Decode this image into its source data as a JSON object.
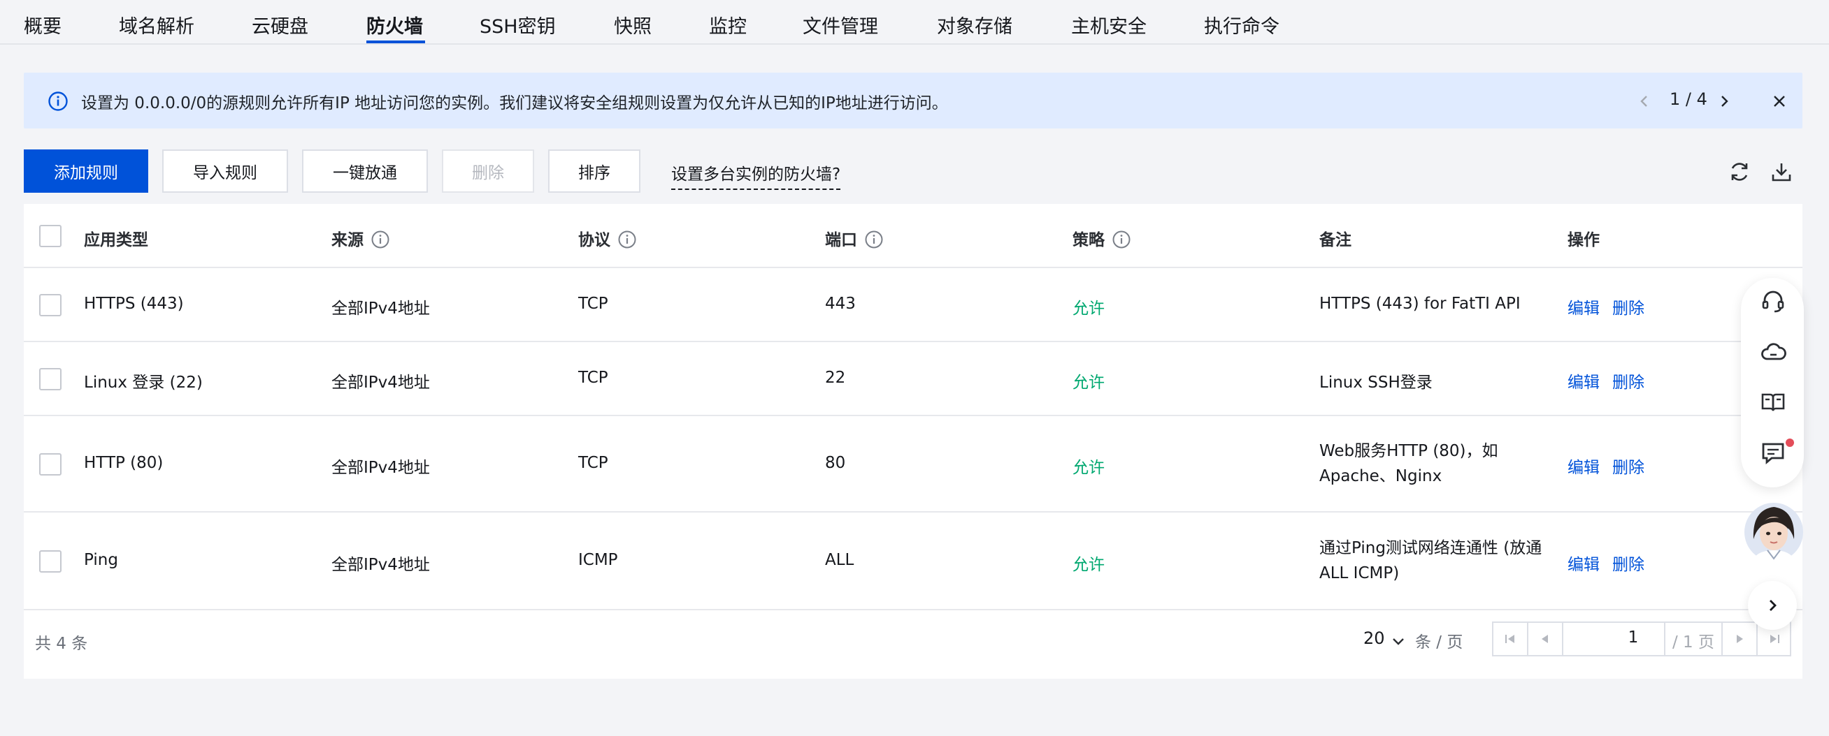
{
  "tabs": [
    {
      "label": "概要"
    },
    {
      "label": "域名解析"
    },
    {
      "label": "云硬盘"
    },
    {
      "label": "防火墙",
      "active": true
    },
    {
      "label": "SSH密钥"
    },
    {
      "label": "快照"
    },
    {
      "label": "监控"
    },
    {
      "label": "文件管理"
    },
    {
      "label": "对象存储"
    },
    {
      "label": "主机安全"
    },
    {
      "label": "执行命令"
    }
  ],
  "notice": {
    "text": "设置为 0.0.0.0/0的源规则允许所有IP 地址访问您的实例。我们建议将安全组规则设置为仅允许从已知的IP地址进行访问。",
    "pager": "1 / 4"
  },
  "toolbar": {
    "add_rule": "添加规则",
    "import_rules": "导入规则",
    "one_click_open": "一键放通",
    "delete": "删除",
    "sort": "排序",
    "multi_instance_help": "设置多台实例的防火墙?"
  },
  "table": {
    "columns": {
      "app_type": "应用类型",
      "source": "来源",
      "protocol": "协议",
      "port": "端口",
      "policy": "策略",
      "note": "备注",
      "actions": "操作"
    },
    "rows": [
      {
        "app_type": "HTTPS (443)",
        "source": "全部IPv4地址",
        "protocol": "TCP",
        "port": "443",
        "policy": "允许",
        "note": "HTTPS (443) for FatTI API",
        "edit": "编辑",
        "delete": "删除"
      },
      {
        "app_type": "Linux 登录 (22)",
        "source": "全部IPv4地址",
        "protocol": "TCP",
        "port": "22",
        "policy": "允许",
        "note": "Linux SSH登录",
        "edit": "编辑",
        "delete": "删除"
      },
      {
        "app_type": "HTTP (80)",
        "source": "全部IPv4地址",
        "protocol": "TCP",
        "port": "80",
        "policy": "允许",
        "note": "Web服务HTTP (80)，如Apache、Nginx",
        "edit": "编辑",
        "delete": "删除"
      },
      {
        "app_type": "Ping",
        "source": "全部IPv4地址",
        "protocol": "ICMP",
        "port": "ALL",
        "policy": "允许",
        "note": "通过Ping测试网络连通性 (放通ALL ICMP)",
        "edit": "编辑",
        "delete": "删除"
      }
    ]
  },
  "footer": {
    "total": "共 4 条",
    "page_size": "20",
    "per_page_unit": "条 / 页",
    "current_page": "1",
    "total_pages": "/ 1 页"
  },
  "colors": {
    "primary": "#0052d9",
    "allow": "#00a870",
    "notice_bg": "#e0ebff",
    "badge_red": "#e34d59"
  }
}
